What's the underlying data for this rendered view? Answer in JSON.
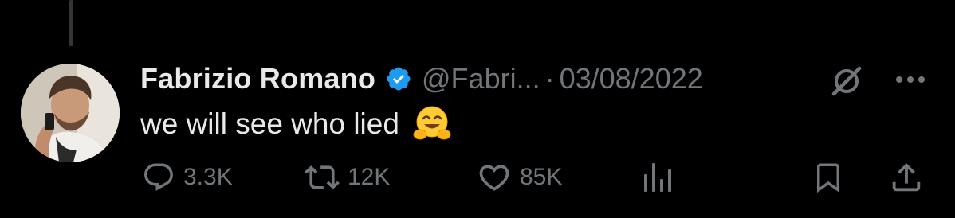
{
  "tweet": {
    "author_name": "Fabrizio Romano",
    "author_handle": "@Fabri...",
    "separator": "·",
    "date": "03/08/2022",
    "text": "we will see who lied",
    "emoji": "hugging-face-emoji",
    "verified": true
  },
  "header_icons": [
    "grok-icon",
    "more-options-icon"
  ],
  "actions": {
    "reply": {
      "icon": "reply-icon",
      "count": "3.3K"
    },
    "retweet": {
      "icon": "retweet-icon",
      "count": "12K"
    },
    "like": {
      "icon": "heart-icon",
      "count": "85K"
    },
    "views": {
      "icon": "views-icon"
    },
    "bookmark": {
      "icon": "bookmark-icon"
    },
    "share": {
      "icon": "share-icon"
    }
  },
  "colors": {
    "background": "#000000",
    "primary_text": "#e7e9ea",
    "secondary_text": "#71767b",
    "verified_badge": "#1d9bf0",
    "thread_line": "#333639"
  }
}
